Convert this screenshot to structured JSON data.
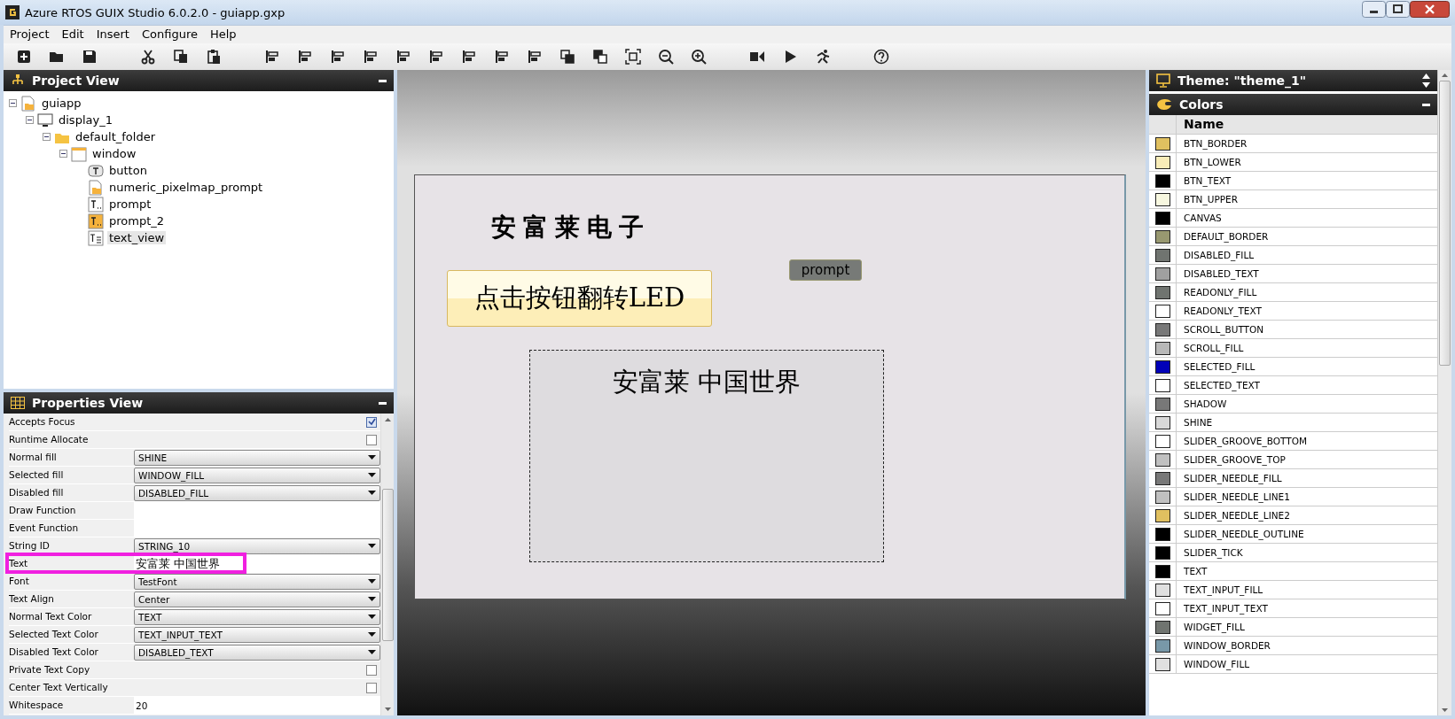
{
  "window": {
    "title": "Azure RTOS GUIX Studio 6.0.2.0 - guiapp.gxp"
  },
  "menu": [
    "Project",
    "Edit",
    "Insert",
    "Configure",
    "Help"
  ],
  "project_view": {
    "title": "Project View",
    "tree": [
      {
        "label": "guiapp",
        "kind": "project",
        "selected": false,
        "expanded": true,
        "children": [
          {
            "label": "display_1",
            "kind": "display",
            "selected": false,
            "expanded": true,
            "children": [
              {
                "label": "default_folder",
                "kind": "folder",
                "selected": false,
                "expanded": true,
                "children": [
                  {
                    "label": "window",
                    "kind": "window",
                    "selected": false,
                    "expanded": true,
                    "children": [
                      {
                        "label": "button",
                        "kind": "button",
                        "selected": false
                      },
                      {
                        "label": "numeric_pixelmap_prompt",
                        "kind": "pixelmap",
                        "selected": false
                      },
                      {
                        "label": "prompt",
                        "kind": "prompt",
                        "selected": false
                      },
                      {
                        "label": "prompt_2",
                        "kind": "prompt_alt",
                        "selected": false
                      },
                      {
                        "label": "text_view",
                        "kind": "textview",
                        "selected": true
                      }
                    ]
                  }
                ]
              }
            ]
          }
        ]
      }
    ]
  },
  "properties_view": {
    "title": "Properties View",
    "rows": [
      {
        "label": "Accepts Focus",
        "kind": "checkbox",
        "checked": true
      },
      {
        "label": "Runtime Allocate",
        "kind": "checkbox",
        "checked": false
      },
      {
        "label": "Normal fill",
        "kind": "dropdown",
        "value": "SHINE"
      },
      {
        "label": "Selected fill",
        "kind": "dropdown",
        "value": "WINDOW_FILL"
      },
      {
        "label": "Disabled fill",
        "kind": "dropdown",
        "value": "DISABLED_FILL"
      },
      {
        "label": "Draw Function",
        "kind": "text",
        "value": ""
      },
      {
        "label": "Event Function",
        "kind": "text",
        "value": ""
      },
      {
        "label": "String ID",
        "kind": "dropdown",
        "value": "STRING_10"
      },
      {
        "label": "Text",
        "kind": "text",
        "value": "安富莱 中国世界",
        "highlighted": true
      },
      {
        "label": "Font",
        "kind": "dropdown",
        "value": "TestFont"
      },
      {
        "label": "Text Align",
        "kind": "dropdown",
        "value": "Center"
      },
      {
        "label": "Normal Text Color",
        "kind": "dropdown",
        "value": "TEXT"
      },
      {
        "label": "Selected Text Color",
        "kind": "dropdown",
        "value": "TEXT_INPUT_TEXT"
      },
      {
        "label": "Disabled Text Color",
        "kind": "dropdown",
        "value": "DISABLED_TEXT"
      },
      {
        "label": "Private Text Copy",
        "kind": "checkbox",
        "checked": false
      },
      {
        "label": "Center Text Vertically",
        "kind": "checkbox",
        "checked": false
      },
      {
        "label": "Whitespace",
        "kind": "text",
        "value": "20"
      }
    ]
  },
  "canvas": {
    "title_text": "安富莱电子",
    "button": "点击按钮翻转LED",
    "prompt": "prompt",
    "text_view": "安富莱 中国世界"
  },
  "theme": {
    "title": "Theme: \"theme_1\""
  },
  "colors": {
    "title": "Colors",
    "column": "Name",
    "items": [
      {
        "name": "BTN_BORDER",
        "color": "#e0c060"
      },
      {
        "name": "BTN_LOWER",
        "color": "#f8ecb8"
      },
      {
        "name": "BTN_TEXT",
        "color": "#000000"
      },
      {
        "name": "BTN_UPPER",
        "color": "#f8f8e0"
      },
      {
        "name": "CANVAS",
        "color": "#000000"
      },
      {
        "name": "DEFAULT_BORDER",
        "color": "#989870"
      },
      {
        "name": "DISABLED_FILL",
        "color": "#707470"
      },
      {
        "name": "DISABLED_TEXT",
        "color": "#a0a0a0"
      },
      {
        "name": "READONLY_FILL",
        "color": "#707470"
      },
      {
        "name": "READONLY_TEXT",
        "color": "#ffffff"
      },
      {
        "name": "SCROLL_BUTTON",
        "color": "#787878"
      },
      {
        "name": "SCROLL_FILL",
        "color": "#b8b8b8"
      },
      {
        "name": "SELECTED_FILL",
        "color": "#0000b8"
      },
      {
        "name": "SELECTED_TEXT",
        "color": "#ffffff"
      },
      {
        "name": "SHADOW",
        "color": "#787878"
      },
      {
        "name": "SHINE",
        "color": "#d8d8d8"
      },
      {
        "name": "SLIDER_GROOVE_BOTTOM",
        "color": "#ffffff"
      },
      {
        "name": "SLIDER_GROOVE_TOP",
        "color": "#c0c0c0"
      },
      {
        "name": "SLIDER_NEEDLE_FILL",
        "color": "#787878"
      },
      {
        "name": "SLIDER_NEEDLE_LINE1",
        "color": "#c0c0c0"
      },
      {
        "name": "SLIDER_NEEDLE_LINE2",
        "color": "#e0c060"
      },
      {
        "name": "SLIDER_NEEDLE_OUTLINE",
        "color": "#000000"
      },
      {
        "name": "SLIDER_TICK",
        "color": "#000000"
      },
      {
        "name": "TEXT",
        "color": "#000000"
      },
      {
        "name": "TEXT_INPUT_FILL",
        "color": "#e0e0e0"
      },
      {
        "name": "TEXT_INPUT_TEXT",
        "color": "#ffffff"
      },
      {
        "name": "WIDGET_FILL",
        "color": "#707470"
      },
      {
        "name": "WINDOW_BORDER",
        "color": "#7898a8"
      },
      {
        "name": "WINDOW_FILL",
        "color": "#e0e0e0"
      }
    ]
  }
}
